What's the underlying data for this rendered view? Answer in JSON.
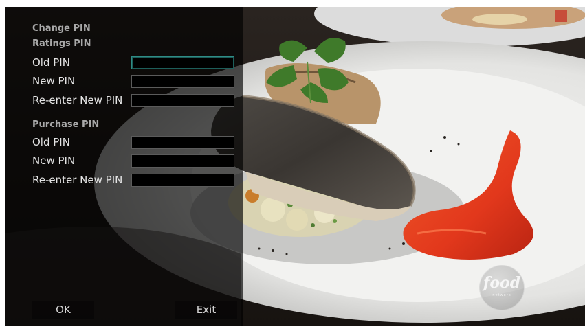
{
  "form": {
    "title": "Change PIN",
    "ratings_section": {
      "title": "Ratings PIN",
      "fields": [
        {
          "label": "Old PIN",
          "value": ""
        },
        {
          "label": "New PIN",
          "value": ""
        },
        {
          "label": "Re-enter New PIN",
          "value": ""
        }
      ]
    },
    "purchase_section": {
      "title": "Purchase PIN",
      "fields": [
        {
          "label": "Old PIN",
          "value": ""
        },
        {
          "label": "New PIN",
          "value": ""
        },
        {
          "label": "Re-enter New PIN",
          "value": ""
        }
      ]
    }
  },
  "softkeys": {
    "ok_label": "OK",
    "exit_label": "Exit"
  },
  "logo": {
    "name": "food-network-logo",
    "word": "food",
    "sub": "network"
  },
  "colors": {
    "focus_border": "#2f8c86",
    "panel_overlay": "rgba(0,0,0,0.66)",
    "sauce": "#e2381c"
  }
}
